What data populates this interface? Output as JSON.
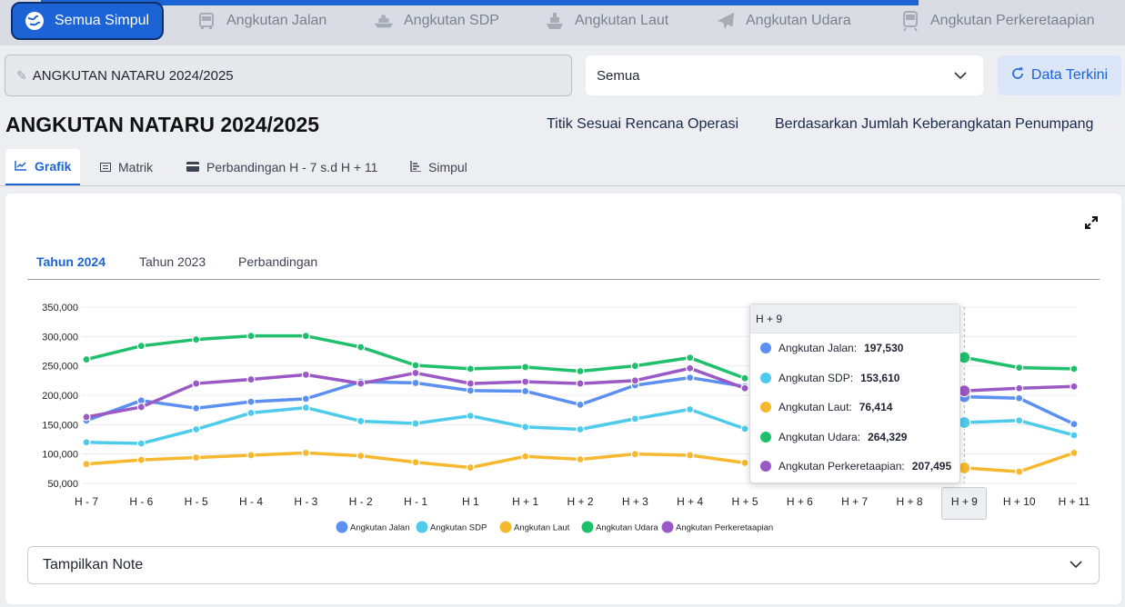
{
  "modes": [
    {
      "label": "Semua Simpul",
      "icon": "globe-icon",
      "active": true
    },
    {
      "label": "Angkutan Jalan",
      "icon": "bus-icon"
    },
    {
      "label": "Angkutan SDP",
      "icon": "ferry-icon"
    },
    {
      "label": "Angkutan Laut",
      "icon": "ship-icon"
    },
    {
      "label": "Angkutan Udara",
      "icon": "plane-icon"
    },
    {
      "label": "Angkutan Perkeretaapian",
      "icon": "train-icon"
    }
  ],
  "filter": {
    "event_value": "ANGKUTAN NATARU 2024/2025",
    "select_value": "Semua",
    "refresh_label": "Data Terkini"
  },
  "header": {
    "title": "ANGKUTAN NATARU 2024/2025",
    "link1": "Titik Sesuai Rencana Operasi",
    "link2": "Berdasarkan Jumlah Keberangkatan Penumpang"
  },
  "view_tabs": [
    {
      "label": "Grafik",
      "icon": "line-chart-icon",
      "active": true
    },
    {
      "label": "Matrik",
      "icon": "table-icon"
    },
    {
      "label": "Perbandingan H - 7 s.d H + 11",
      "icon": "card-icon"
    },
    {
      "label": "Simpul",
      "icon": "bar-list-icon"
    }
  ],
  "year_tabs": [
    {
      "label": "Tahun 2024",
      "active": true
    },
    {
      "label": "Tahun 2023"
    },
    {
      "label": "Perbandingan"
    }
  ],
  "chart_data": {
    "type": "line",
    "categories": [
      "H - 7",
      "H - 6",
      "H - 5",
      "H - 4",
      "H - 3",
      "H - 2",
      "H - 1",
      "H 1",
      "H + 1",
      "H + 2",
      "H + 3",
      "H + 4",
      "H + 5",
      "H + 6",
      "H + 7",
      "H + 8",
      "H + 9",
      "H + 10",
      "H + 11"
    ],
    "y_ticks": [
      "350,000",
      "300,000",
      "250,000",
      "200,000",
      "150,000",
      "100,000",
      "50,000"
    ],
    "ylim": [
      50000,
      350000
    ],
    "grid": true,
    "legend_position": "bottom",
    "series": [
      {
        "name": "Angkutan Jalan",
        "color": "#5b8ff0",
        "values": [
          157000,
          191000,
          178000,
          189000,
          194000,
          223000,
          221000,
          208000,
          207000,
          184000,
          217000,
          230000,
          215000,
          null,
          null,
          null,
          197530,
          195000,
          151000
        ]
      },
      {
        "name": "Angkutan SDP",
        "color": "#4ecbea",
        "values": [
          120000,
          118000,
          142000,
          170000,
          179000,
          156000,
          152000,
          165000,
          146000,
          142000,
          160000,
          176000,
          143000,
          null,
          null,
          null,
          153610,
          157000,
          132000
        ]
      },
      {
        "name": "Angkutan Laut",
        "color": "#f5b82e",
        "values": [
          83000,
          90000,
          94000,
          98000,
          102000,
          97000,
          86000,
          77000,
          96000,
          91000,
          100000,
          98000,
          85000,
          null,
          null,
          null,
          76414,
          70000,
          102000
        ]
      },
      {
        "name": "Angkutan Udara",
        "color": "#1fbf6c",
        "values": [
          261000,
          284000,
          295000,
          301000,
          301000,
          282000,
          251000,
          245000,
          248000,
          241000,
          250000,
          264000,
          229000,
          null,
          null,
          null,
          264329,
          247000,
          245000
        ]
      },
      {
        "name": "Angkutan Perkeretaapian",
        "color": "#9b59c6",
        "values": [
          163000,
          180000,
          220000,
          227000,
          235000,
          220000,
          238000,
          220000,
          223000,
          220000,
          225000,
          246000,
          212000,
          null,
          null,
          null,
          207495,
          212000,
          215000
        ]
      }
    ]
  },
  "tooltip": {
    "category": "H + 9",
    "rows": [
      {
        "name": "Angkutan Jalan:",
        "value": "197,530",
        "color": "#5b8ff0"
      },
      {
        "name": "Angkutan SDP:",
        "value": "153,610",
        "color": "#4ecbea"
      },
      {
        "name": "Angkutan Laut:",
        "value": "76,414",
        "color": "#f5b82e"
      },
      {
        "name": "Angkutan Udara:",
        "value": "264,329",
        "color": "#1fbf6c"
      },
      {
        "name": "Angkutan Perkeretaapian:",
        "value": "207,495",
        "color": "#9b59c6"
      }
    ]
  },
  "note": {
    "label": "Tampilkan Note"
  }
}
